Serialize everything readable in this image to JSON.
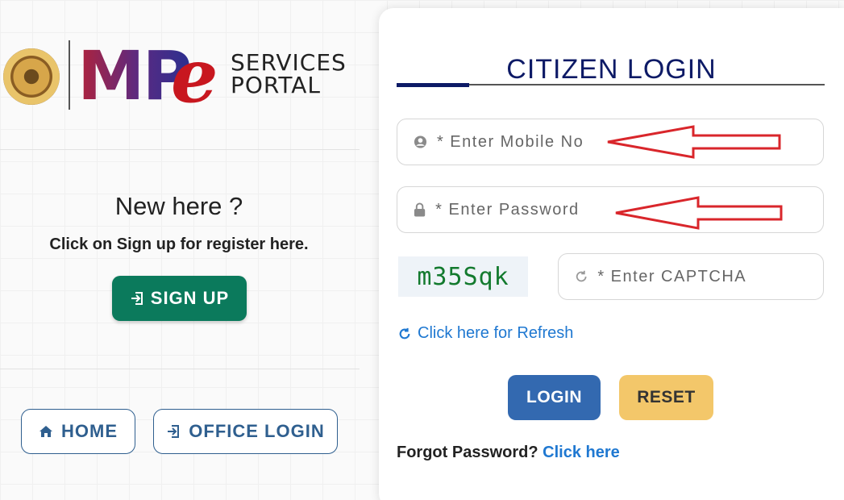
{
  "brand": {
    "mp": "MP",
    "e": "e",
    "line1": "SERVICES",
    "line2": "PORTAL"
  },
  "left": {
    "heading": "New here ?",
    "subtext": "Click on Sign up for register here.",
    "signup_label": "SIGN UP",
    "home_label": "HOME",
    "office_label": "OFFICE LOGIN"
  },
  "login": {
    "title": "CITIZEN LOGIN",
    "mobile_placeholder": "* Enter Mobile No",
    "password_placeholder": "* Enter Password",
    "captcha_text": "m35Sqk",
    "captcha_placeholder": "* Enter CAPTCHA",
    "refresh_label": "Click here for Refresh",
    "login_label": "LOGIN",
    "reset_label": "RESET",
    "forgot_text": "Forgot Password?",
    "forgot_link": "Click here"
  },
  "colors": {
    "title": "#0d1a66",
    "signup": "#0b7a5c",
    "login": "#3369b0",
    "reset": "#f3c76a",
    "link": "#1f78d1",
    "annotation_arrow": "#d9262b"
  },
  "icons": {
    "mobile": "user-circle-icon",
    "password": "lock-icon",
    "captcha": "refresh-icon",
    "signup": "sign-in-icon",
    "home": "home-icon",
    "office": "sign-in-icon"
  }
}
